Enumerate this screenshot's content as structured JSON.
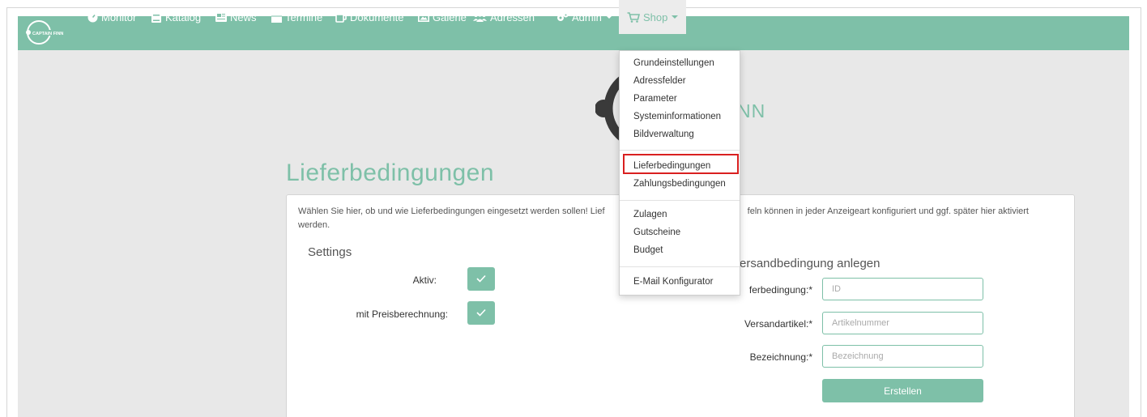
{
  "brand": {
    "logo_text": "CAPTAIN FINN",
    "hero_text": "NN"
  },
  "nav": {
    "items": [
      {
        "label": "Monitor",
        "icon": "dashboard-icon"
      },
      {
        "label": "Katalog",
        "icon": "book-icon"
      },
      {
        "label": "News",
        "icon": "newspaper-icon"
      },
      {
        "label": "Termine",
        "icon": "calendar-icon"
      },
      {
        "label": "Dokumente",
        "icon": "copy-icon"
      },
      {
        "label": "Galerie",
        "icon": "picture-icon"
      },
      {
        "label": "Adressen",
        "icon": "users-icon"
      },
      {
        "label": "Admin",
        "icon": "cogs-icon"
      },
      {
        "label": "Shop",
        "icon": "cart-icon"
      }
    ]
  },
  "shop_menu": {
    "group1": [
      "Grundeinstellungen",
      "Adressfelder",
      "Parameter",
      "Systeminformationen",
      "Bildverwaltung"
    ],
    "group2": [
      "Lieferbedingungen",
      "Zahlungsbedingungen"
    ],
    "group3": [
      "Zulagen",
      "Gutscheine",
      "Budget"
    ],
    "group4": [
      "E-Mail Konfigurator"
    ],
    "highlighted": "Lieferbedingungen"
  },
  "page": {
    "title": "Lieferbedingungen",
    "intro_left": "Wählen Sie hier, ob und wie Lieferbedingungen eingesetzt werden sollen! Lief",
    "intro_right": "feln können in jeder Anzeigeart konfiguriert und ggf. später hier aktiviert",
    "intro_line2": "werden."
  },
  "settings": {
    "title": "Settings",
    "aktiv_label": "Aktiv:",
    "aktiv_checked": true,
    "preis_label": "mit Preisberechnung:",
    "preis_checked": true
  },
  "create_form": {
    "title": "ersandbedingung anlegen",
    "id_label": "ferbedingung:*",
    "id_placeholder": "ID",
    "artikel_label": "Versandartikel:*",
    "artikel_placeholder": "Artikelnummer",
    "bez_label": "Bezeichnung:*",
    "bez_placeholder": "Bezeichnung",
    "submit_label": "Erstellen"
  },
  "colors": {
    "accent": "#7ec0a8",
    "highlight": "#d92020",
    "content_bg": "#e8e8e8"
  }
}
